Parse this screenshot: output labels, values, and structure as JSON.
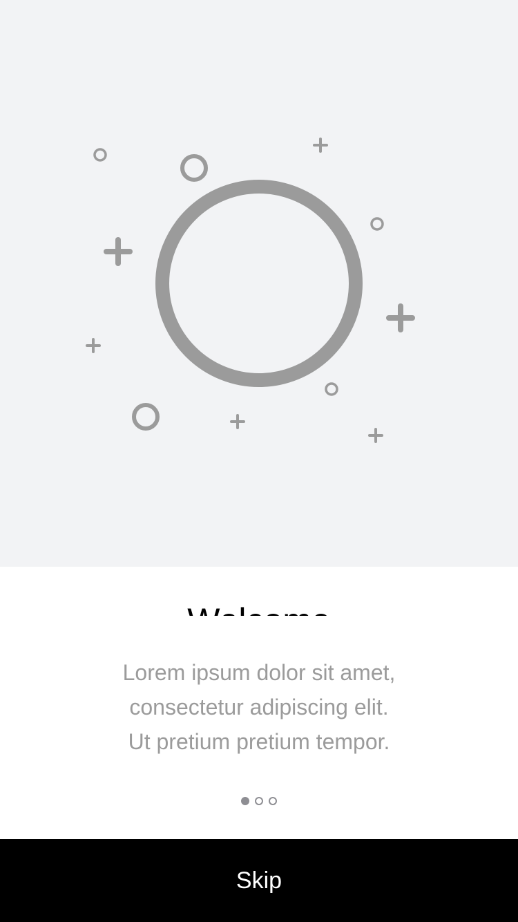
{
  "hero": {
    "illustration": "circle-with-sparkles-illustration",
    "stroke_color": "#9b9b9b",
    "background": "#f2f3f5"
  },
  "onboarding": {
    "title": "Welcome",
    "body_lines": [
      "Lorem ipsum dolor sit amet,",
      "consectetur adipiscing elit.",
      "Ut pretium pretium tempor."
    ],
    "page_indicator": {
      "count": 3,
      "current": 1
    }
  },
  "footer": {
    "skip_label": "Skip",
    "background": "#000000"
  }
}
